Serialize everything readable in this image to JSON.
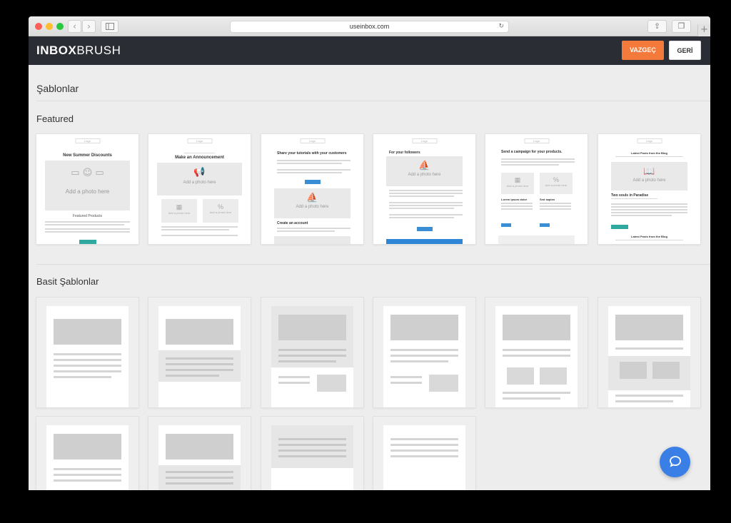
{
  "browser": {
    "url": "useinbox.com",
    "back_glyph": "‹",
    "forward_glyph": "›",
    "reload_glyph": "↻",
    "share_glyph": "⇪",
    "tabs_glyph": "❐",
    "plus_glyph": "+"
  },
  "app": {
    "logo_bold": "INBOX",
    "logo_light": "BRUSH",
    "cancel_label": "VAZGEÇ",
    "back_label": "GERİ",
    "accent_color": "#f47a3b",
    "header_color": "#2a2d33"
  },
  "page": {
    "title": "Şablonlar",
    "featured_title": "Featured",
    "basic_title": "Basit Şablonlar"
  },
  "featured_templates": [
    {
      "logo": "Logo",
      "title": "New Summer Discounts",
      "photo_label": "Add a photo here",
      "section": "Featured Products"
    },
    {
      "logo": "Logo",
      "title": "Make an Announcement",
      "photo_label": "Add a photo here",
      "small_photo_1": "Add a photo here",
      "small_photo_2": "Add a photo here",
      "small_icon_2": "%"
    },
    {
      "logo": "Logo",
      "title": "Share your tutorials with your customers",
      "photo_label": "Add a photo here",
      "section": "Create an account"
    },
    {
      "logo": "Logo",
      "title": "For your followers",
      "photo_label": "Add a photo here"
    },
    {
      "logo": "Logo",
      "title": "Send a campaign for your products.",
      "small_photo_1": "Add a photo here",
      "small_photo_2": "Add a photo here",
      "small_icon_2": "%",
      "col_1_title": "Lorem ipsum dolor",
      "col_2_title": "Sed sapien"
    },
    {
      "logo": "Logo",
      "title": "Latest Posts from the Blog",
      "photo_label": "Add a photo here",
      "post_title": "Two souls in Paradise",
      "footer_title": "Latest Posts from the Blog"
    }
  ],
  "help": {
    "icon": "help-chat-icon",
    "glyph": "◯"
  }
}
